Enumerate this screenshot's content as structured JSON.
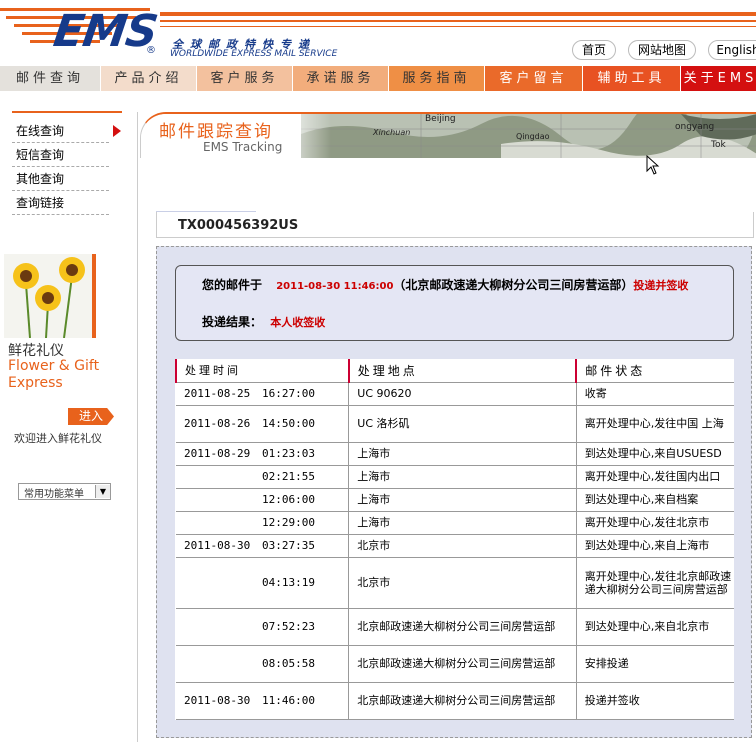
{
  "header": {
    "logo_text": "EMS",
    "logo_registered": "®",
    "tagline_cn": "全球邮政特快专递",
    "tagline_en": "WORLDWIDE EXPRESS MAIL SERVICE",
    "links": [
      "首页",
      "网站地图",
      "English"
    ]
  },
  "nav": {
    "items": [
      {
        "label": "邮件查询",
        "color": "#e4e1dc"
      },
      {
        "label": "产品介绍",
        "color": "#f3dccb"
      },
      {
        "label": "客户服务",
        "color": "#f3c19e"
      },
      {
        "label": "承诺服务",
        "color": "#f2ad7c"
      },
      {
        "label": "服务指南",
        "color": "#ef8f45"
      },
      {
        "label": "客户留言",
        "color": "#ea6a2a"
      },
      {
        "label": "辅助工具",
        "color": "#e85222"
      },
      {
        "label": "关于EMS",
        "color": "#d41010"
      }
    ]
  },
  "sidebar": {
    "items": [
      {
        "label": "在线查询"
      },
      {
        "label": "短信查询"
      },
      {
        "label": "其他查询"
      },
      {
        "label": "查询链接"
      }
    ],
    "promo_cn": "鲜花礼仪",
    "promo_en_1": "Flower & Gift",
    "promo_en_2": "Express",
    "enter_label": "进入",
    "welcome_text": "欢迎进入鲜花礼仪",
    "menu_select": "常用功能菜单"
  },
  "banner": {
    "title": "邮件跟踪查询",
    "subtitle": "EMS Tracking",
    "map_labels": [
      "Beijing",
      "Xinchuan",
      "Qingdao",
      "ongyang",
      "Tok"
    ]
  },
  "tracking": {
    "number": "TX000456392US",
    "summary_prefix": "您的邮件于",
    "summary_time": "2011-08-30 11:46:00",
    "summary_office": "（北京邮政速递大柳树分公司三间房营运部）",
    "summary_status": "投递并签收",
    "result_label": "投递结果：",
    "result_value": "本人收签收",
    "columns": [
      "处理时间",
      "处理地点",
      "邮件状态"
    ],
    "rows": [
      {
        "date": "2011-08-25",
        "time": "16:27:00",
        "place": "UC 90620",
        "status": "收寄"
      },
      {
        "date": "2011-08-26",
        "time": "14:50:00",
        "place": "UC 洛杉矶",
        "status": "离开处理中心,发往中国 上海"
      },
      {
        "date": "2011-08-29",
        "time": "01:23:03",
        "place": "上海市",
        "status": "到达处理中心,来自USUESD"
      },
      {
        "date": "",
        "time": "02:21:55",
        "place": "上海市",
        "status": "离开处理中心,发往国内出口"
      },
      {
        "date": "",
        "time": "12:06:00",
        "place": "上海市",
        "status": "到达处理中心,来自档案"
      },
      {
        "date": "",
        "time": "12:29:00",
        "place": "上海市",
        "status": "离开处理中心,发往北京市"
      },
      {
        "date": "2011-08-30",
        "time": "03:27:35",
        "place": "北京市",
        "status": "到达处理中心,来自上海市"
      },
      {
        "date": "",
        "time": "04:13:19",
        "place": "北京市",
        "status": "离开处理中心,发往北京邮政速递大柳树分公司三间房营运部"
      },
      {
        "date": "",
        "time": "07:52:23",
        "place": "北京邮政速递大柳树分公司三间房营运部",
        "status": "到达处理中心,来自北京市"
      },
      {
        "date": "",
        "time": "08:05:58",
        "place": "北京邮政速递大柳树分公司三间房营运部",
        "status": "安排投递"
      },
      {
        "date": "2011-08-30",
        "time": "11:46:00",
        "place": "北京邮政速递大柳树分公司三间房营运部",
        "status": "投递并签收"
      }
    ]
  },
  "colors": {
    "brand_blue": "#163a8a",
    "brand_orange": "#e8621c",
    "accent_red": "#cc0000"
  }
}
